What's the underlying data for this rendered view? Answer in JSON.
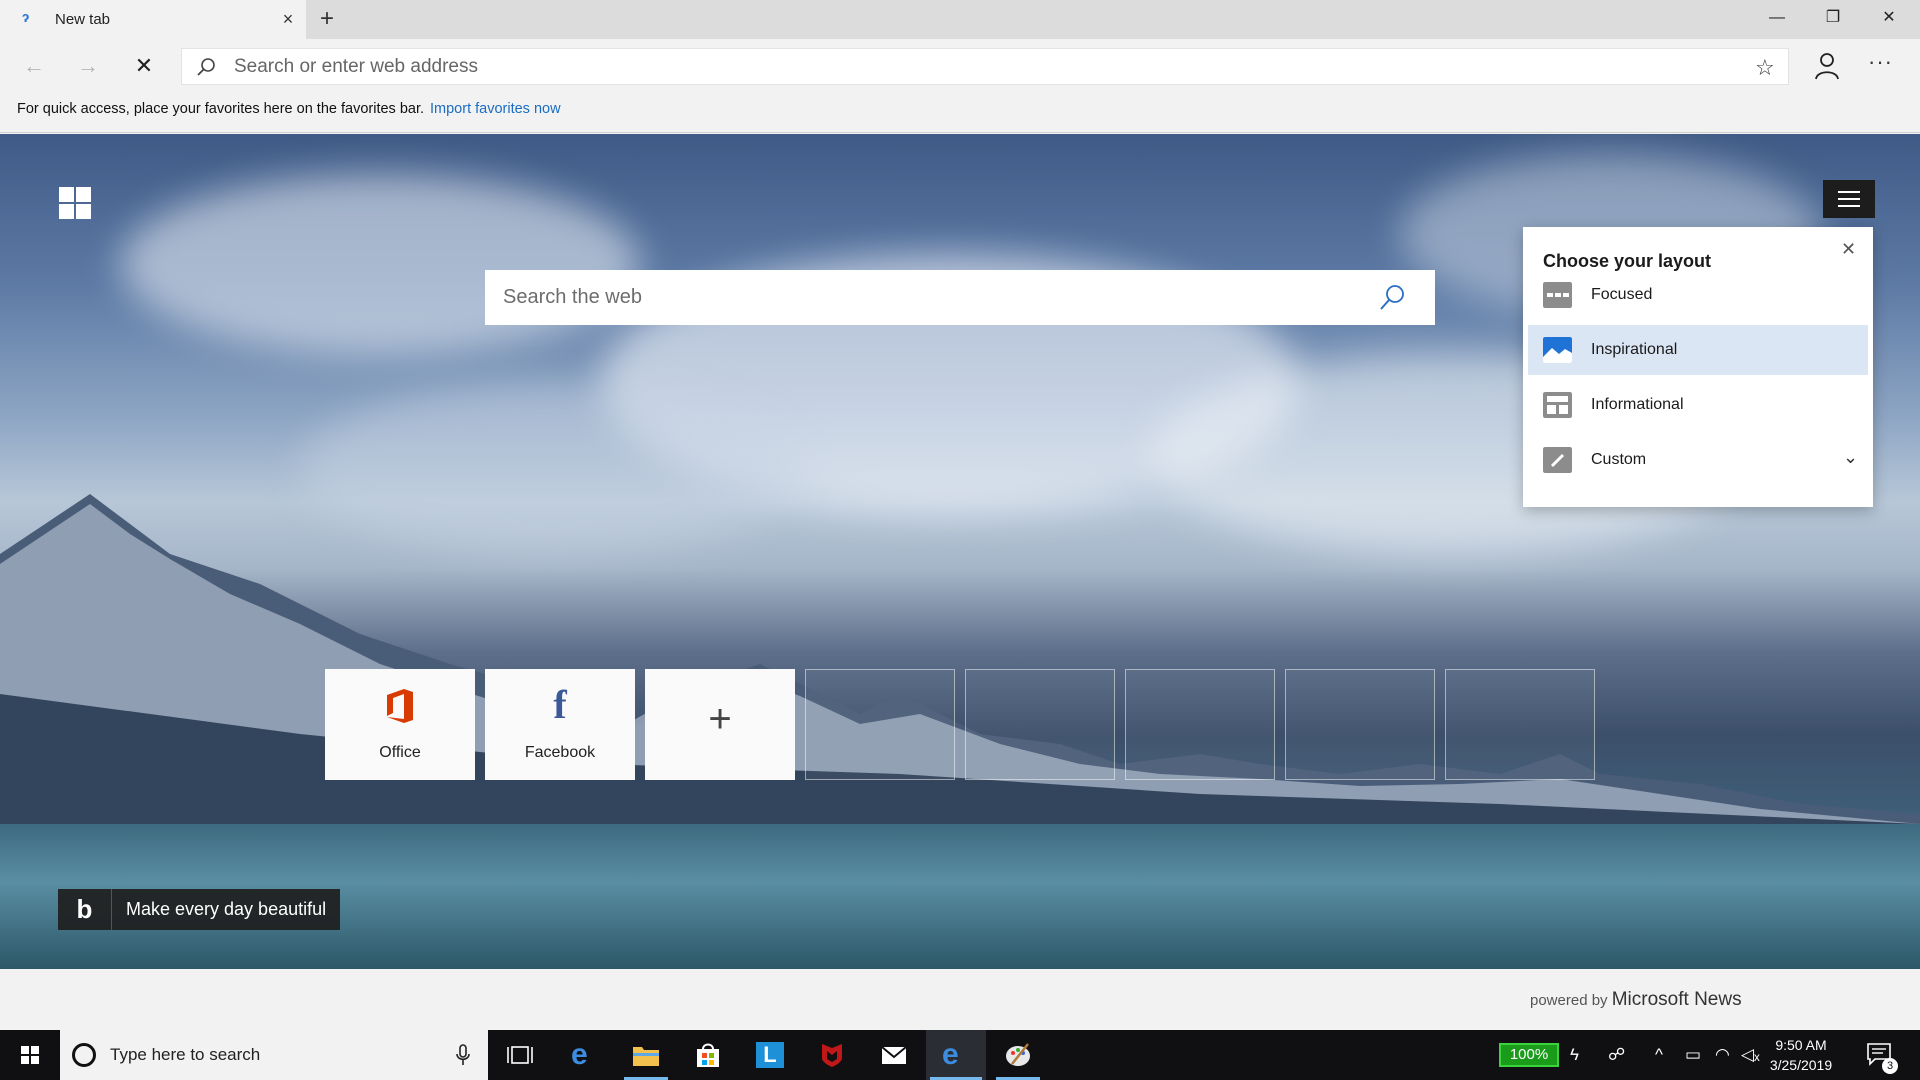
{
  "browser": {
    "tab": {
      "title": "New tab",
      "close": "×"
    },
    "new_tab": "+",
    "window": {
      "minimize": "—",
      "restore": "❐",
      "close": "✕"
    },
    "nav": {
      "back": "←",
      "forward": "→",
      "stop": "✕"
    },
    "address": {
      "placeholder": "Search or enter web address",
      "value": ""
    },
    "favorite_star": "☆",
    "more": "···"
  },
  "favorites_bar": {
    "text": "For quick access, place your favorites here on the favorites bar.",
    "link": "Import favorites now"
  },
  "newtab": {
    "search_placeholder": "Search the web",
    "layout_panel": {
      "title": "Choose your layout",
      "close": "✕",
      "options": [
        {
          "label": "Focused",
          "selected": false
        },
        {
          "label": "Inspirational",
          "selected": true
        },
        {
          "label": "Informational",
          "selected": false
        },
        {
          "label": "Custom",
          "selected": false,
          "chevron": "⌄"
        }
      ]
    },
    "top_sites": [
      {
        "label": "Office",
        "icon": "office-logo"
      },
      {
        "label": "Facebook",
        "icon": "facebook-logo",
        "glyph": "f"
      },
      {
        "label": "",
        "icon": "plus-icon",
        "glyph": "+"
      }
    ],
    "bing_badge": {
      "logo": "b",
      "text": "Make every day beautiful"
    },
    "powered_by": {
      "prefix": "powered by",
      "brand": "Microsoft News"
    }
  },
  "taskbar": {
    "search_placeholder": "Type here to search",
    "battery": "100%",
    "time": "9:50 AM",
    "date": "3/25/2019",
    "notifications": "3"
  },
  "colors": {
    "accent": "#1a6dc2",
    "selected_option": "#dbe6f4",
    "office": "#d83b01",
    "facebook": "#3b5998",
    "battery": "#1a9b1a"
  }
}
